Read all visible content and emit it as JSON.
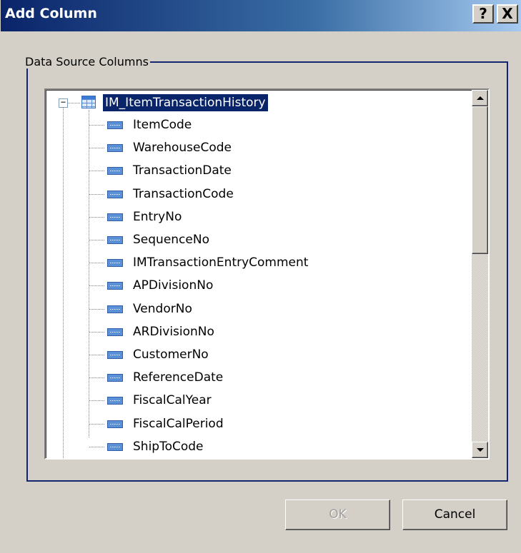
{
  "window": {
    "title": "Add Column",
    "help_label": "?",
    "close_label": "X"
  },
  "group": {
    "legend": "Data Source Columns"
  },
  "tree": {
    "root": {
      "label": "IM_ItemTransactionHistory",
      "expanded": true,
      "selected": true,
      "icon": "table-icon",
      "expander": "−"
    },
    "children": [
      {
        "label": "ItemCode",
        "icon": "column-icon"
      },
      {
        "label": "WarehouseCode",
        "icon": "column-icon"
      },
      {
        "label": "TransactionDate",
        "icon": "column-icon"
      },
      {
        "label": "TransactionCode",
        "icon": "column-icon"
      },
      {
        "label": "EntryNo",
        "icon": "column-icon"
      },
      {
        "label": "SequenceNo",
        "icon": "column-icon"
      },
      {
        "label": "IMTransactionEntryComment",
        "icon": "column-icon"
      },
      {
        "label": "APDivisionNo",
        "icon": "column-icon"
      },
      {
        "label": "VendorNo",
        "icon": "column-icon"
      },
      {
        "label": "ARDivisionNo",
        "icon": "column-icon"
      },
      {
        "label": "CustomerNo",
        "icon": "column-icon"
      },
      {
        "label": "ReferenceDate",
        "icon": "column-icon"
      },
      {
        "label": "FiscalCalYear",
        "icon": "column-icon"
      },
      {
        "label": "FiscalCalPeriod",
        "icon": "column-icon"
      },
      {
        "label": "ShipToCode",
        "icon": "column-icon"
      }
    ]
  },
  "buttons": {
    "ok_label": "OK",
    "ok_enabled": false,
    "cancel_label": "Cancel"
  }
}
